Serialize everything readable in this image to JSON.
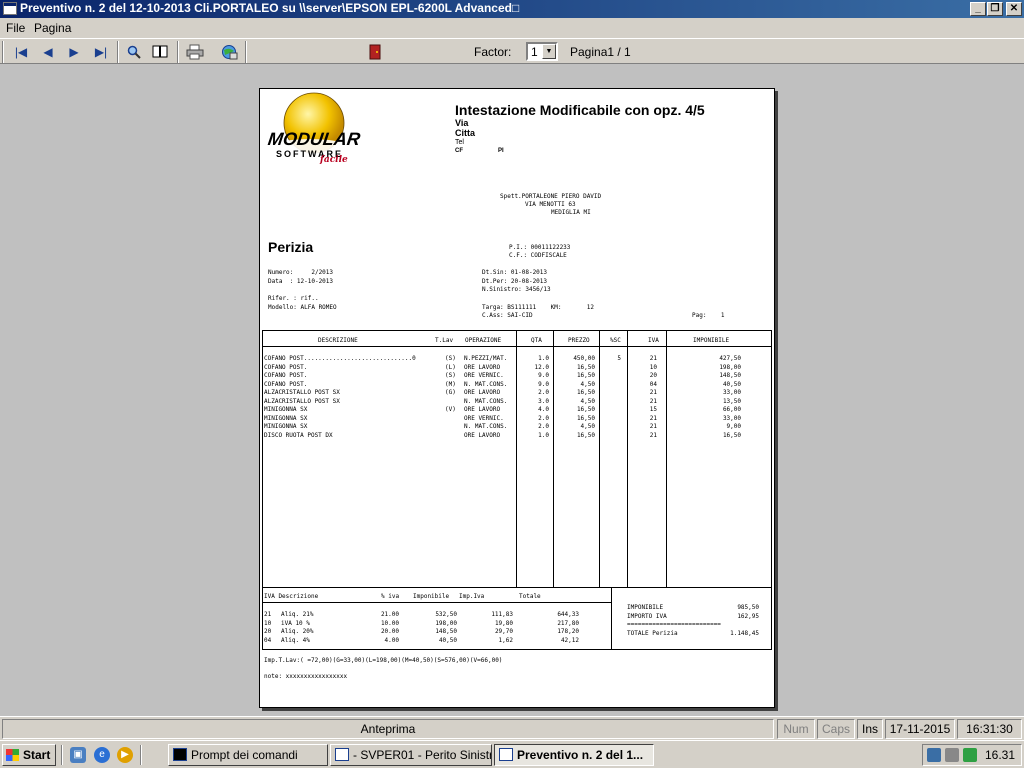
{
  "window": {
    "title": "Preventivo n.  2 del 12-10-2013 Cli.PORTALEO su \\\\server\\EPSON EPL-6200L Advanced□",
    "min_glyph": "_",
    "max_glyph": "❐",
    "close_glyph": "✕"
  },
  "menu": {
    "file": "File",
    "pagina": "Pagina"
  },
  "toolbar": {
    "first_glyph": "|◀",
    "prev_glyph": "◀",
    "next_glyph": "▶",
    "last_glyph": "▶|",
    "factor_label": "Factor:",
    "factor_value": "1",
    "page_info": "Pagina1 / 1"
  },
  "document": {
    "logo_line1": "MODULAR",
    "logo_line2": "SOFTWARE",
    "logo_line3": "facile",
    "header_title": "Intestazione Modificabile con opz. 4/5",
    "header_via": "Via",
    "header_citta": "Citta",
    "header_tel": "Tel",
    "header_cf": "CF",
    "header_pi": "PI",
    "client_name": "Spett.PORTALEONE PIERO DAVID",
    "client_street": "VIA MENOTTI 63",
    "client_city": "MEDIGLIA MI",
    "doc_title": "Perizia",
    "pi": "P.I.: 00011122233",
    "cf": "C.F.: CODFISCALE",
    "numero": "Numero:     2/2013",
    "data": "Data  : 12-10-2013",
    "dt_sin": "Dt.Sin: 01-08-2013",
    "dt_per": "Dt.Per: 20-08-2013",
    "n_sinistro": "N.Sinistro: 3456/13",
    "rifer": "Rifer. : rif..",
    "modello": "Modello: ALFA ROMEO",
    "targa": "Targa: BS111111    KM:       12",
    "c_ass": "C.Ass: SAI-CID",
    "pag": "Pag:    1",
    "columns": [
      "DESCRIZIONE",
      "T.Lav",
      "OPERAZIONE",
      "QTA",
      "PREZZO",
      "%SC",
      "IVA",
      "IMPONIBILE"
    ],
    "rows": [
      {
        "desc": "COFANO POST..............................0",
        "tlav": "(S)",
        "op": "N.PEZZI/MAT.",
        "qta": "1.0",
        "prezzo": "450,00",
        "sc": "5",
        "iva": "21",
        "imp": "427,50"
      },
      {
        "desc": "COFANO POST.",
        "tlav": "(L)",
        "op": "ORE LAVORO",
        "qta": "12.0",
        "prezzo": "16,50",
        "sc": "",
        "iva": "10",
        "imp": "198,00"
      },
      {
        "desc": "COFANO POST.",
        "tlav": "(S)",
        "op": "ORE VERNIC.",
        "qta": "9.0",
        "prezzo": "16,50",
        "sc": "",
        "iva": "20",
        "imp": "148,50"
      },
      {
        "desc": "COFANO POST.",
        "tlav": "(M)",
        "op": "N. MAT.CONS.",
        "qta": "9.0",
        "prezzo": "4,50",
        "sc": "",
        "iva": "04",
        "imp": "40,50"
      },
      {
        "desc": "ALZACRISTALLO POST SX",
        "tlav": "(G)",
        "op": "ORE LAVORO",
        "qta": "2.0",
        "prezzo": "16,50",
        "sc": "",
        "iva": "21",
        "imp": "33,00"
      },
      {
        "desc": "ALZACRISTALLO POST SX",
        "tlav": "",
        "op": "N. MAT.CONS.",
        "qta": "3.0",
        "prezzo": "4,50",
        "sc": "",
        "iva": "21",
        "imp": "13,50"
      },
      {
        "desc": "MINIGONNA SX",
        "tlav": "(V)",
        "op": "ORE LAVORO",
        "qta": "4.0",
        "prezzo": "16,50",
        "sc": "",
        "iva": "15",
        "imp": "66,00"
      },
      {
        "desc": "MINIGONNA SX",
        "tlav": "",
        "op": "ORE VERNIC.",
        "qta": "2.0",
        "prezzo": "16,50",
        "sc": "",
        "iva": "21",
        "imp": "33,00"
      },
      {
        "desc": "MINIGONNA SX",
        "tlav": "",
        "op": "N. MAT.CONS.",
        "qta": "2.0",
        "prezzo": "4,50",
        "sc": "",
        "iva": "21",
        "imp": "9,00"
      },
      {
        "desc": "DISCO RUOTA POST DX",
        "tlav": "",
        "op": "ORE LAVORO",
        "qta": "1.0",
        "prezzo": "16,50",
        "sc": "",
        "iva": "21",
        "imp": "16,50"
      }
    ],
    "iva_columns": [
      "IVA Descrizione",
      "% iva",
      "Imponibile",
      "Imp.Iva",
      "Totale"
    ],
    "iva_rows": [
      {
        "code": "21",
        "desc": "Aliq. 21%",
        "pct": "21.00",
        "imp": "532,50",
        "iva": "111,83",
        "tot": "644,33"
      },
      {
        "code": "10",
        "desc": "iVA 10 %",
        "pct": "10.00",
        "imp": "198,00",
        "iva": "19,80",
        "tot": "217,80"
      },
      {
        "code": "20",
        "desc": "Aliq. 20%",
        "pct": "20.00",
        "imp": "148,50",
        "iva": "29,70",
        "tot": "178,20"
      },
      {
        "code": "04",
        "desc": "Aliq. 4%",
        "pct": "4.00",
        "imp": "40,50",
        "iva": "1,62",
        "tot": "42,12"
      }
    ],
    "tot_imponibile_label": "IMPONIBILE",
    "tot_imponibile": "985,50",
    "tot_iva_label": "IMPORTO IVA",
    "tot_iva": "162,95",
    "tot_separator": "==========================",
    "tot_perizia_label": "TOTALE Perizia",
    "tot_perizia": "1.148,45",
    "imp_t_lav": "Imp.T.Lav:( =72,00)(G=33,00)(L=198,00)(M=40,50)(S=576,00)(V=66,00)",
    "note": "note: xxxxxxxxxxxxxxxxx"
  },
  "statusbar": {
    "mode": "Anteprima",
    "num": "Num",
    "caps": "Caps",
    "ins": "Ins",
    "date": "17-11-2015",
    "time": "16:31:30"
  },
  "taskbar": {
    "start": "Start",
    "tasks": [
      {
        "label": "Prompt dei comandi",
        "active": false
      },
      {
        "label": "- SVPER01 - Perito Sinistr...",
        "active": false
      },
      {
        "label": "Preventivo n.   2 del 1...",
        "active": true
      }
    ],
    "clock": "16.31"
  },
  "colors": {
    "titlebar_start": "#0a246a",
    "titlebar_end": "#3a6ea5",
    "workspace": "#c0c0c0",
    "chrome": "#d4d0c8",
    "logo_yellow": "#f2c200"
  }
}
